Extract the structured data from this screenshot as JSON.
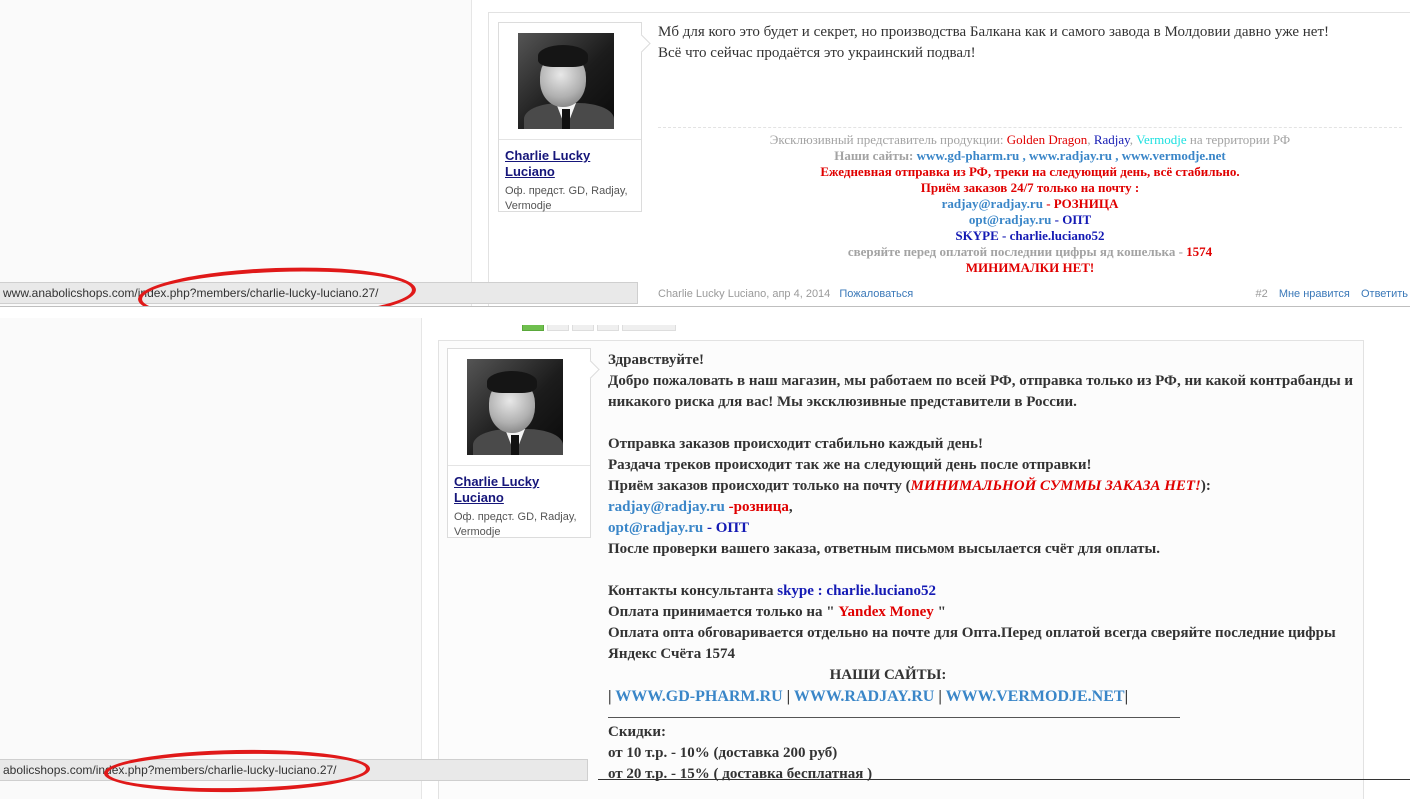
{
  "top_post": {
    "user": {
      "name": "Charlie Lucky Luciano",
      "title": "Оф. предст. GD, Radjay, Vermodje"
    },
    "message": [
      "Мб для кого это будет и секрет, но производства Балкана как и самого завода в Молдовии давно уже нет!",
      "Всё что сейчас продаётся это украинский подвал!"
    ],
    "signature": {
      "line1_prefix": "Эксклюзивный представитель продукции: ",
      "brand_gd": "Golden Dragon",
      "comma1": ", ",
      "brand_radjay": "Radjay",
      "comma2": ", ",
      "brand_vermodje": "Vermodje",
      "line1_suffix": " на территории РФ",
      "sites_label": "Наши сайты: ",
      "site1": "www.gd-pharm.ru",
      "sep1": " , ",
      "site2": "www.radjay.ru",
      "sep2": " , ",
      "site3": "www.vermodje.net",
      "shipping": "Ежедневная отправка из РФ, треки на следующий день, всё стабильно.",
      "orders": "Приём заказов 24/7 только на почту :",
      "email_retail": "radjay@radjay.ru",
      "retail_label": " - РОЗНИЦА",
      "email_opt": "opt@radjay.ru",
      "opt_label": " - ОПТ",
      "skype": "SKYPE - charlie.luciano52",
      "check_text": "сверяйте перед оплатой последнии цифры яд кошелька - ",
      "check_digits": "1574",
      "no_minimum": "МИНИМАЛКИ НЕТ!"
    },
    "footer": {
      "author": "Charlie Lucky Luciano",
      "date": ", апр 4, 2014",
      "report": "Пожаловаться",
      "post_num": "#2",
      "like": "Мне нравится",
      "reply": "Ответить"
    }
  },
  "statusbar_top": "www.anabolicshops.com/index.php?members/charlie-lucky-luciano.27/",
  "statusbar_bottom": "abolicshops.com/index.php?members/charlie-lucky-luciano.27/",
  "bottom_post": {
    "user": {
      "name": "Charlie Lucky Luciano",
      "title": "Оф. предст. GD, Radjay, Vermodje"
    },
    "greeting": "Здравствуйте!",
    "welcome": "Добро пожаловать в наш магазин, мы работаем по всей РФ, отправка только из РФ, ни какой контрабанды и никакого риска для вас! Мы эксклюзивные представители в России.",
    "ship1": "Отправка заказов происходит стабильно каждый день!",
    "ship2": "Раздача треков происходит так же на следующий день после отправки!",
    "orders_prefix": "Приём заказов происходит только на почту (",
    "orders_emph": "МИНИМАЛЬНОЙ СУММЫ ЗАКАЗА НЕТ!",
    "orders_suffix": "):",
    "email_retail": "radjay@radjay.ru",
    "retail_label": " -розница",
    "retail_comma": ",",
    "email_opt": "opt@radjay.ru",
    "opt_label": " - ОПТ",
    "invoice": "После проверки вашего заказа, ответным письмом высылается счёт для оплаты.",
    "contacts_prefix": "Контакты консультанта ",
    "contacts_skype": "skype : charlie.luciano52",
    "payment_prefix": "Оплата принимается только на \" ",
    "payment_method": "Yandex Money",
    "payment_suffix": " \"",
    "opt_payment": "Оплата опта обговаривается отдельно на почте для Опта.Перед оплатой всегда сверяйте последние цифры Яндекс Счёта 1574",
    "sites_heading": "НАШИ САЙТЫ:",
    "sites_pipe_start": "| ",
    "site1": "WWW.GD-PHARM.RU",
    "site_sep1": " | ",
    "site2": "WWW.RADJAY.RU",
    "site_sep2": " | ",
    "site3": "WWW.VERMODJE.NET",
    "sites_pipe_end": "|",
    "discounts_heading": "Скидки:",
    "discount1": "от 10 т.р. - 10% (доставка 200 руб)",
    "discount2": "от 20 т.р. - 15% ( доставка бесплатная )"
  },
  "colors": {
    "annotation": "#e01919",
    "link": "#3a86c8",
    "red_text": "#e00000",
    "blue_text": "#141ab4"
  }
}
